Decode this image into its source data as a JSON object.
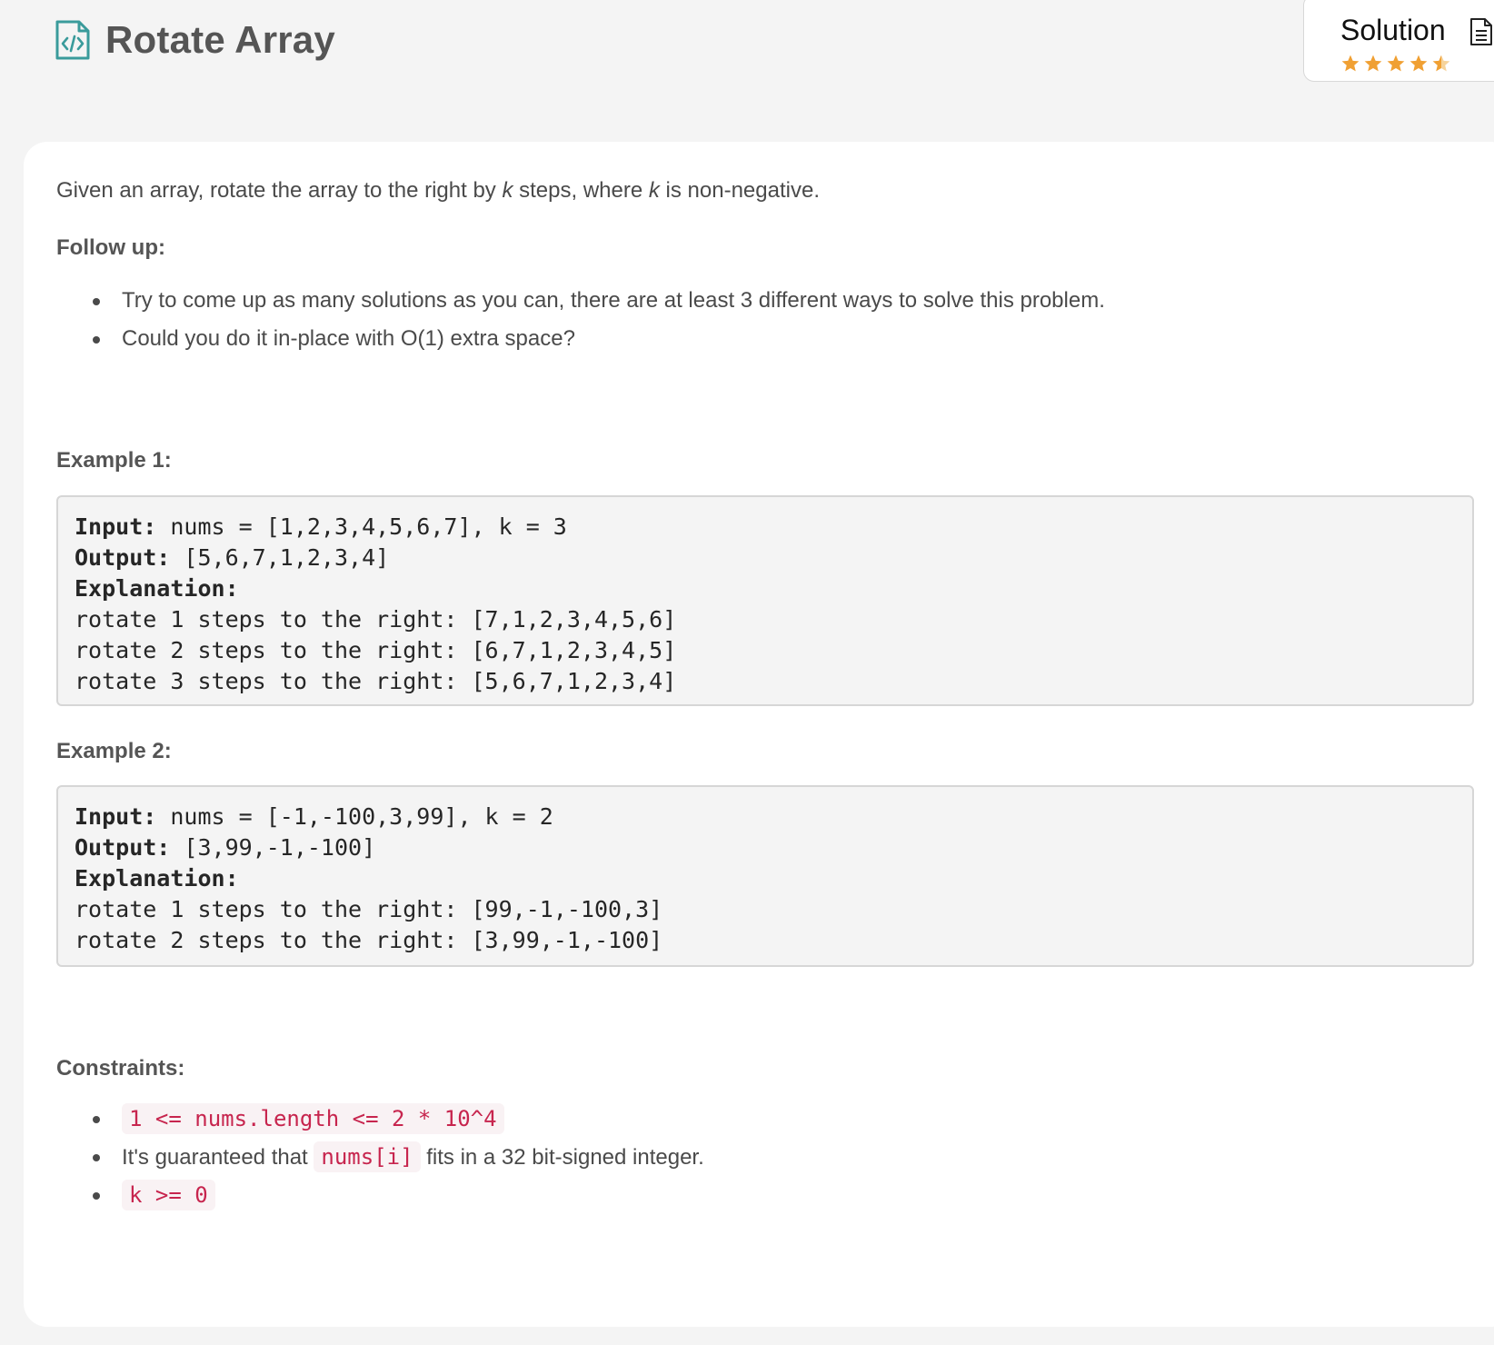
{
  "header": {
    "title": "Rotate Array",
    "title_icon": "code-file-icon",
    "accent_color": "#3a9b9b"
  },
  "solution": {
    "label": "Solution",
    "icon": "document-icon",
    "rating": 4.5,
    "rating_max": 5,
    "star_color": "#f0a033"
  },
  "problem": {
    "description": {
      "part1": "Given an array, rotate the array to the right by ",
      "var1": "k",
      "part2": " steps, where ",
      "var2": "k",
      "part3": " is non-negative."
    },
    "follow_up": {
      "heading": "Follow up:",
      "items": [
        "Try to come up as many solutions as you can, there are at least 3 different ways to solve this problem.",
        "Could you do it in-place with O(1) extra space?"
      ]
    },
    "examples": [
      {
        "heading": "Example 1:",
        "input_label": "Input:",
        "input": " nums = [1,2,3,4,5,6,7], k = 3",
        "output_label": "Output:",
        "output": " [5,6,7,1,2,3,4]",
        "explanation_label": "Explanation:",
        "steps": [
          "rotate 1 steps to the right: [7,1,2,3,4,5,6]",
          "rotate 2 steps to the right: [6,7,1,2,3,4,5]",
          "rotate 3 steps to the right: [5,6,7,1,2,3,4]"
        ]
      },
      {
        "heading": "Example 2:",
        "input_label": "Input:",
        "input": " nums = [-1,-100,3,99], k = 2",
        "output_label": "Output:",
        "output": " [3,99,-1,-100]",
        "explanation_label": "Explanation:",
        "steps": [
          "rotate 1 steps to the right: [99,-1,-100,3]",
          "rotate 2 steps to the right: [3,99,-1,-100]"
        ]
      }
    ],
    "constraints": {
      "heading": "Constraints:",
      "c1_code": "1 <= nums.length <= 2 * 10^4",
      "c2_pre": "It's guaranteed that ",
      "c2_code": "nums[i]",
      "c2_post": " fits in a 32 bit-signed integer.",
      "c3_code": "k >= 0"
    }
  }
}
